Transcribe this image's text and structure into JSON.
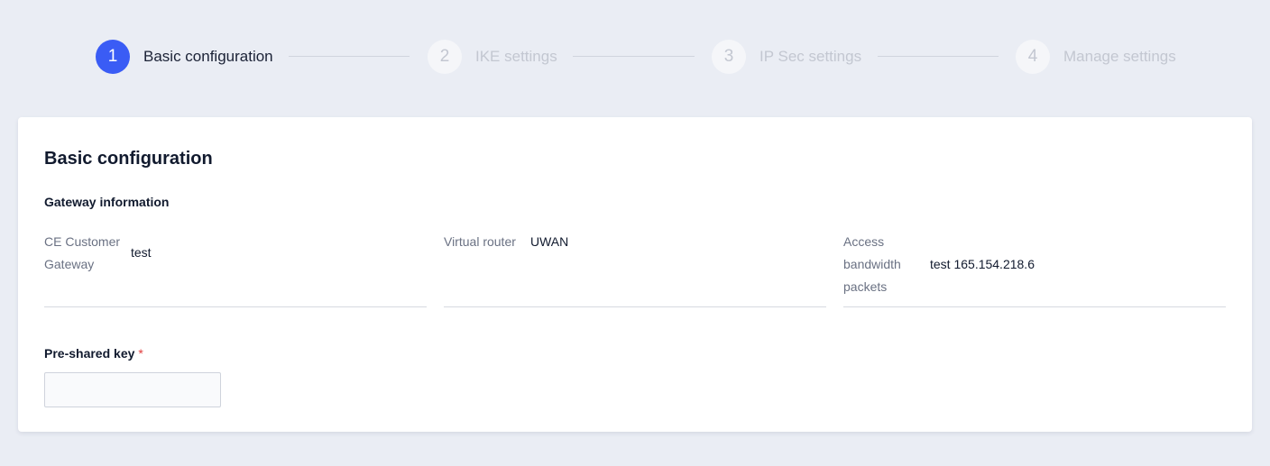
{
  "stepper": {
    "steps": [
      {
        "number": "1",
        "label": "Basic configuration",
        "state": "active"
      },
      {
        "number": "2",
        "label": "IKE settings",
        "state": "inactive"
      },
      {
        "number": "3",
        "label": "IP Sec settings",
        "state": "inactive"
      },
      {
        "number": "4",
        "label": "Manage settings",
        "state": "inactive"
      }
    ]
  },
  "card": {
    "title": "Basic configuration",
    "section_title": "Gateway information",
    "fields": {
      "ce_gateway": {
        "label_line1": "CE Customer",
        "label_line2": "Gateway",
        "value": "test"
      },
      "virtual_router": {
        "label": "Virtual router",
        "value": "UWAN"
      },
      "access_bandwidth": {
        "label_line1": "Access",
        "label_line2": "bandwidth",
        "label_line3": "packets",
        "value": "test 165.154.218.6"
      }
    },
    "pre_shared_key": {
      "label": "Pre-shared key",
      "required_mark": "*",
      "value": "",
      "placeholder": ""
    }
  },
  "colors": {
    "accent": "#3a5cf5",
    "background": "#eaedf4",
    "required": "#e03b3b"
  }
}
